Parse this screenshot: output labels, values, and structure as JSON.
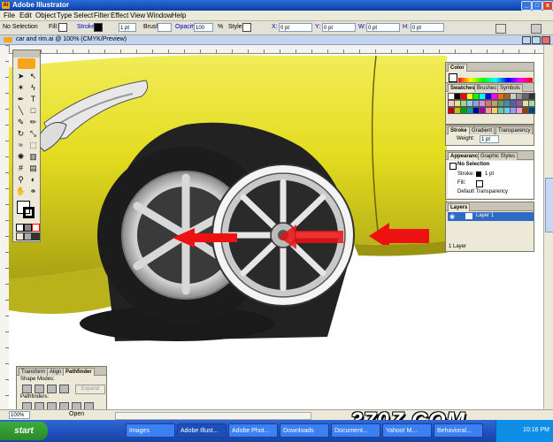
{
  "app": {
    "title": "Adobe Illustrator",
    "icon": "illustrator-app-icon",
    "window_buttons": [
      "_",
      "□",
      "x"
    ]
  },
  "menus": [
    "File",
    "Edit",
    "Object",
    "Type",
    "Select",
    "Filter",
    "Effect",
    "View",
    "Window",
    "Help"
  ],
  "controlbar": {
    "selection": "No Selection",
    "fill_label": "Fill:",
    "stroke_label": "Stroke:",
    "stroke_weight": "1 pt",
    "brush_label": "Brush:",
    "opacity_label": "Opacity:",
    "opacity_value": "100",
    "percent": "%",
    "style_label": "Style:",
    "x_label": "X:",
    "y_label": "Y:",
    "w_label": "W:",
    "h_label": "H:",
    "x_value": "0 pt",
    "y_value": "0 pt",
    "w_value": "0 pt",
    "h_value": "0 pt"
  },
  "document": {
    "title": "car and rim.ai @ 100% (CMYK/Preview)",
    "zoom": "100%",
    "status": "Open"
  },
  "color_panel": {
    "tab": "Color",
    "accent": "#f0e21a"
  },
  "swatches_panel": {
    "tabs": [
      "Swatches",
      "Brushes",
      "Symbols"
    ],
    "colors": [
      "#ffffff",
      "#000000",
      "#ff0000",
      "#ffff00",
      "#00ff00",
      "#00ffff",
      "#0000ff",
      "#ff00ff",
      "#ff6600",
      "#996633",
      "#cccccc",
      "#999999",
      "#666666",
      "#333333",
      "#f7c6c6",
      "#f4e07a",
      "#9fd68a",
      "#8ad0e6",
      "#8fa2e0",
      "#d08fe0",
      "#e07070",
      "#c0a060",
      "#60a060",
      "#4090a0",
      "#5060b0",
      "#a050a0",
      "#e0e0a0",
      "#a0e0a0",
      "#c00000",
      "#c0c000",
      "#00a000",
      "#00a0a0",
      "#0000a0",
      "#a000a0",
      "#ff9999",
      "#ffcc66",
      "#66cc99",
      "#66ccff",
      "#9999ff",
      "#ff99cc",
      "#884400",
      "#004488"
    ]
  },
  "stroke_panel": {
    "tabs": [
      "Stroke",
      "Gradient",
      "Transparency"
    ],
    "weight_label": "Weight:",
    "weight_value": "1 pt"
  },
  "appearance_panel": {
    "tabs": [
      "Appearance",
      "Graphic Styles"
    ],
    "title": "No Selection",
    "stroke_label": "Stroke:",
    "stroke_value": "1 pt",
    "fill_label": "Fill:",
    "transparency": "Default Transparency"
  },
  "layers_panel": {
    "tab": "Layers",
    "layer_name": "Layer 1",
    "footer": "1 Layer"
  },
  "pathfinder_panel": {
    "tabs": [
      "Transform",
      "Align",
      "Pathfinder"
    ],
    "shape_modes": "Shape Modes:",
    "expand": "Expand",
    "pathfinders": "Pathfinders:"
  },
  "taskbar": {
    "start": "start",
    "tasks": [
      "Images",
      "Adobe Illust...",
      "Adobe Phot...",
      "Downloads",
      "Document...",
      "Yahoo! M...",
      "Behavioral..."
    ],
    "time": "10:16 PM"
  },
  "watermark": "370Z.COM",
  "colors": {
    "car_body": "#e3dc1f",
    "arrow": "#ee1111",
    "titlebar": "#0a3fa6",
    "taskbar": "#245edb"
  }
}
